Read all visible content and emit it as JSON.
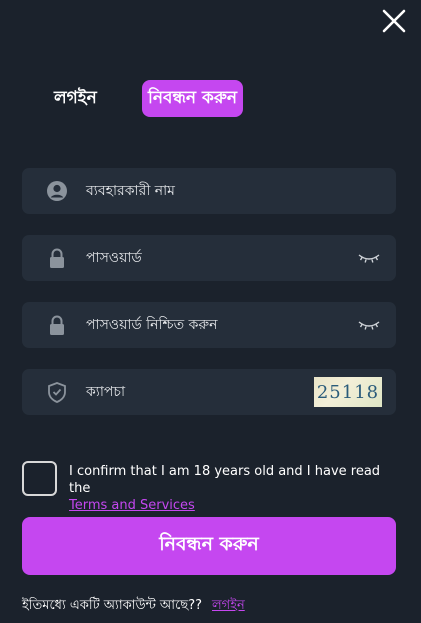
{
  "icons": {
    "close": "close-icon",
    "user": "user-icon",
    "lock": "lock-icon",
    "eye": "eye-closed-icon",
    "shield": "shield-check-icon"
  },
  "colors": {
    "background": "#1b222c",
    "field": "#252e3a",
    "accent": "#c547f0"
  },
  "tabs": {
    "login": "লগইন",
    "register": "নিবন্ধন করুন"
  },
  "fields": {
    "username": "ব্যবহারকারী নাম",
    "password": "পাসওয়ার্ড",
    "confirm_password": "পাসওয়ার্ড নিশ্চিত করুন",
    "captcha": "ক্যাপচা",
    "captcha_code": "25118"
  },
  "terms": {
    "text": "I confirm that I am 18 years old and I have read the",
    "link": "Terms and Services"
  },
  "submit_label": "নিবন্ধন করুন",
  "footer": {
    "text": "ইতিমধ্যে একটি অ্যাকাউন্ট আছে??",
    "link": "লগইন"
  }
}
